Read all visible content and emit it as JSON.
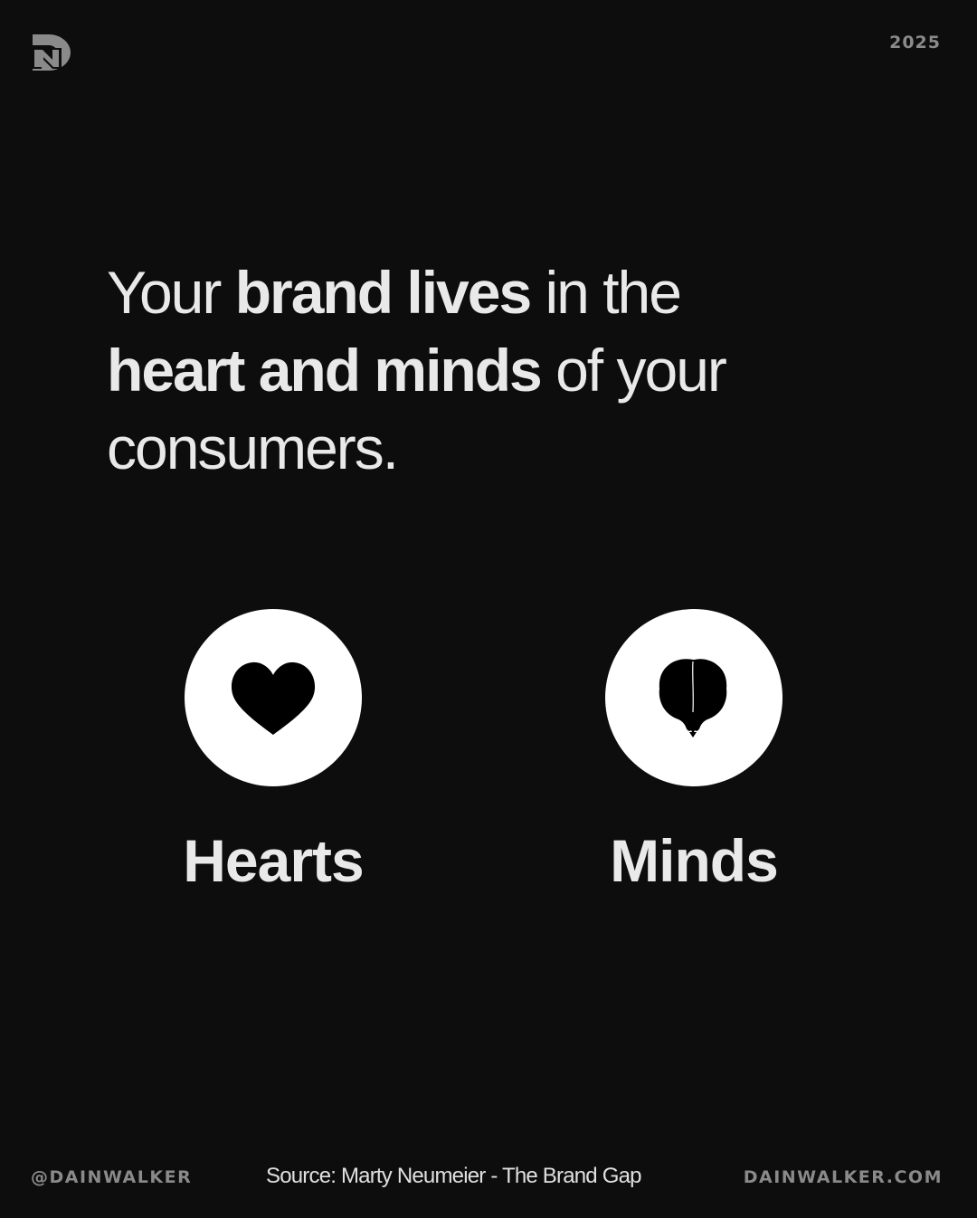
{
  "header": {
    "logo_text": "DW",
    "year": "2025"
  },
  "headline": {
    "part1": "Your ",
    "part2_bold": "brand lives",
    "part3": " in the ",
    "part4_bold": "heart and minds",
    "part5": " of your consumers."
  },
  "pillars": [
    {
      "label": "Hearts",
      "icon": "heart-icon"
    },
    {
      "label": "Minds",
      "icon": "brain-icon"
    }
  ],
  "footer": {
    "handle": "@DAINWALKER",
    "source": "Source: Marty Neumeier - The Brand Gap",
    "website": "DAINWALKER.COM"
  },
  "colors": {
    "background": "#0d0d0d",
    "text": "#e9e9e9",
    "muted": "#8a8a8a",
    "circle": "#ffffff",
    "icon": "#000000"
  }
}
